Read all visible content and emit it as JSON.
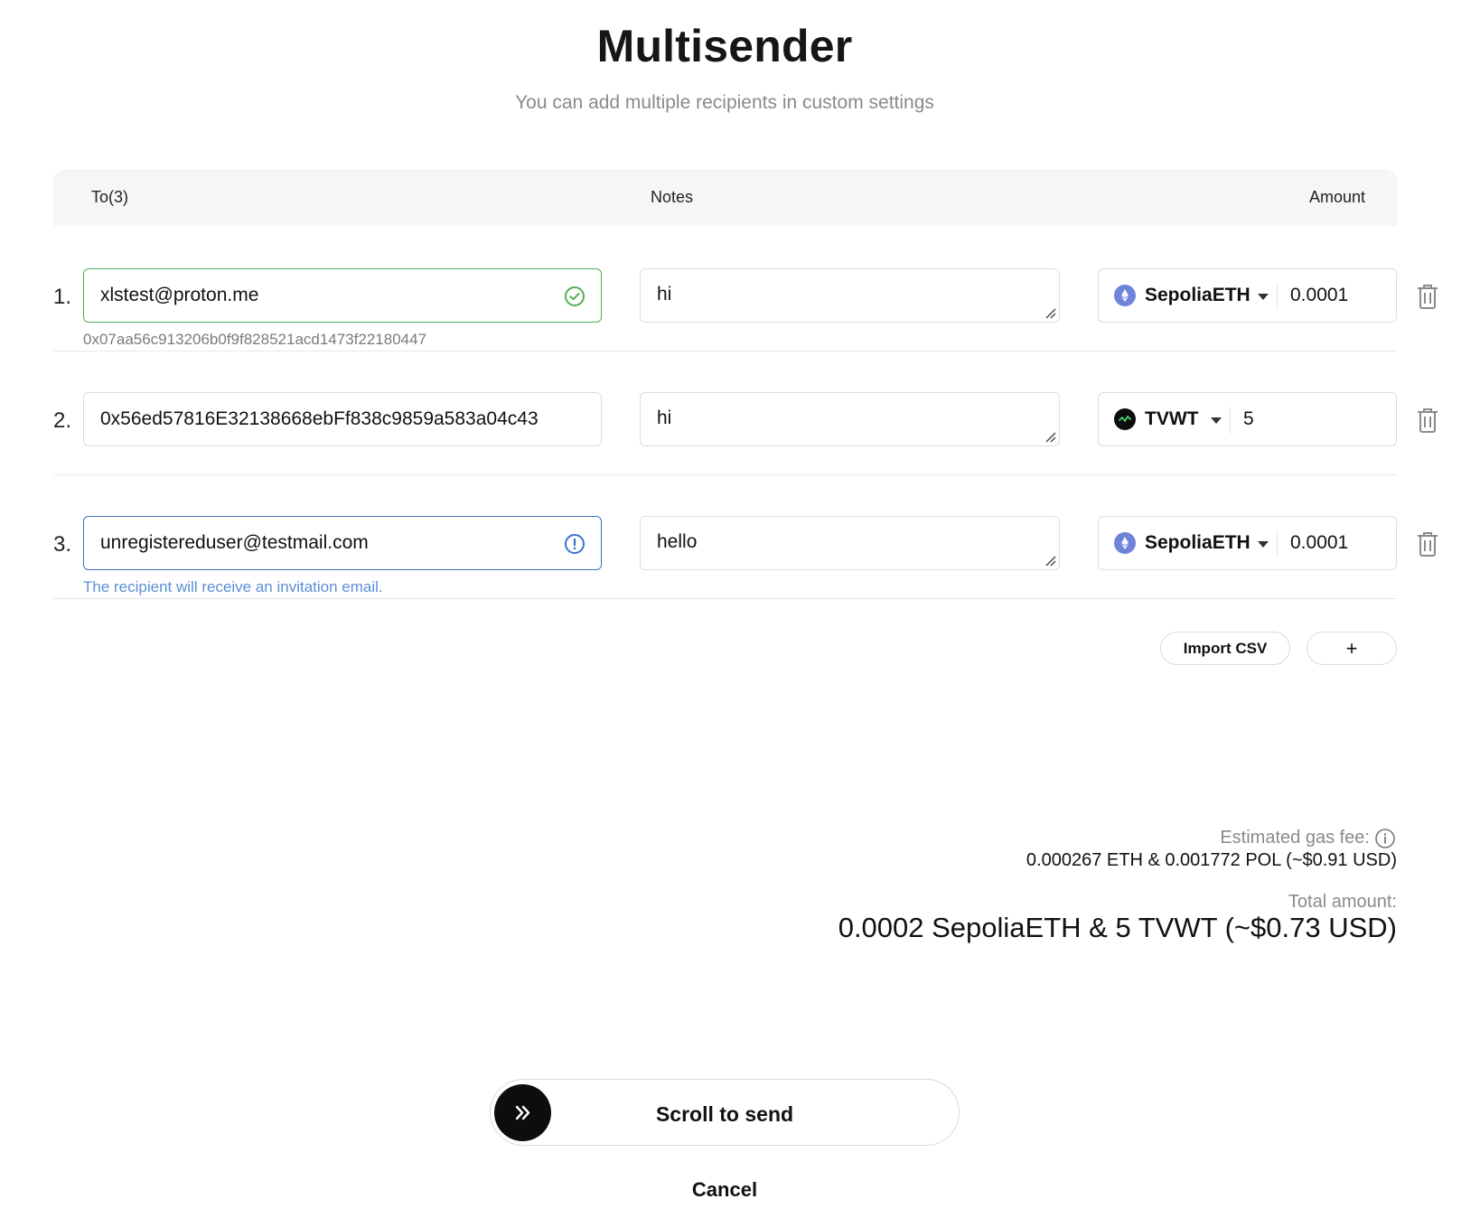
{
  "header": {
    "title": "Multisender",
    "subtitle": "You can add multiple recipients in custom settings"
  },
  "table_header": {
    "to": "To(3)",
    "notes": "Notes",
    "amount": "Amount"
  },
  "rows": [
    {
      "number": "1.",
      "recipient": "xlstest@proton.me",
      "recipient_status": "valid",
      "sub_text": "0x07aa56c913206b0f9f828521acd1473f22180447",
      "note": "hi",
      "token": "SepoliaETH",
      "token_icon": "ethereum-icon",
      "amount": "0.0001"
    },
    {
      "number": "2.",
      "recipient": "0x56ed57816E32138668ebFf838c9859a583a04c43",
      "recipient_status": "none",
      "sub_text": "",
      "note": "hi",
      "token": "TVWT",
      "token_icon": "tvwt-icon",
      "amount": "5"
    },
    {
      "number": "3.",
      "recipient": "unregistereduser@testmail.com",
      "recipient_status": "info",
      "sub_text": "The recipient will receive an invitation email.",
      "note": "hello",
      "token": "SepoliaETH",
      "token_icon": "ethereum-icon",
      "amount": "0.0001"
    }
  ],
  "actions": {
    "import_csv": "Import CSV",
    "add": "+"
  },
  "summary": {
    "gas_label": "Estimated gas fee:",
    "gas_value": "0.000267 ETH & 0.001772 POL (~$0.91 USD)",
    "total_label": "Total amount:",
    "total_value": "0.0002 SepoliaETH & 5 TVWT (~$0.73 USD)"
  },
  "footer": {
    "slider_label": "Scroll to send",
    "cancel": "Cancel"
  },
  "colors": {
    "valid": "#4fae57",
    "info": "#3b72c9",
    "invite_text": "#5b8fd6",
    "ethereum": "#6d84d9"
  }
}
